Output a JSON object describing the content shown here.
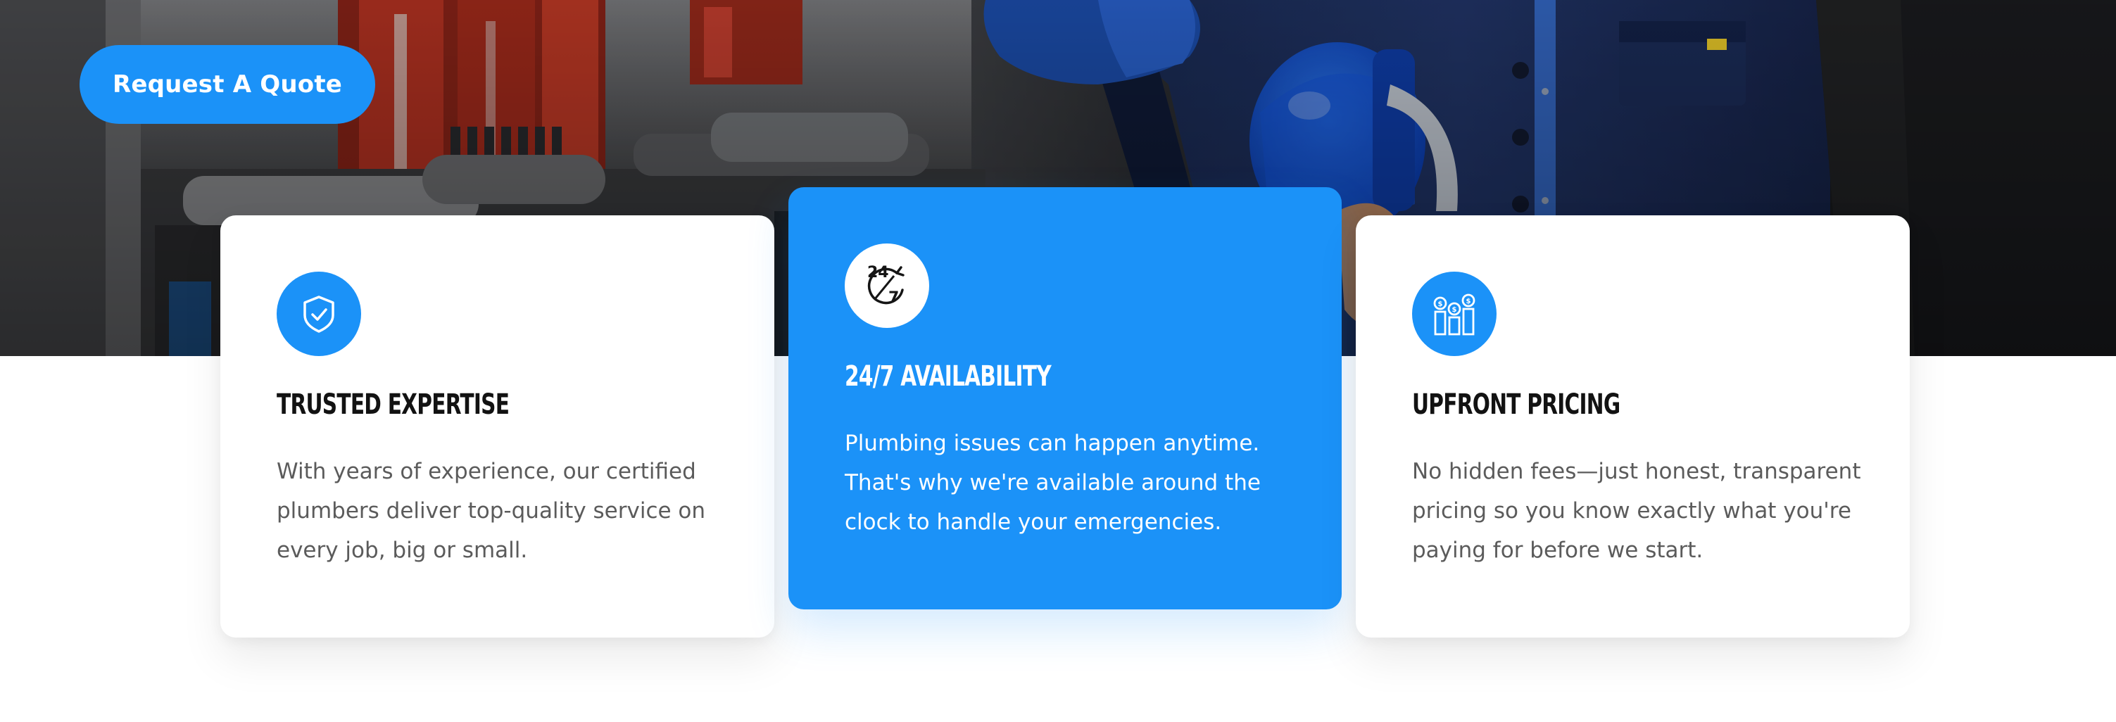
{
  "hero": {
    "cta_label": "Request A Quote"
  },
  "features": [
    {
      "icon": "shield-check-icon",
      "title": "Trusted Expertise",
      "text": "With years of experience, our certified plumbers deliver top-quality service on every job, big or small."
    },
    {
      "icon": "clock-24-7-icon",
      "title": "24/7 Availability",
      "text": "Plumbing issues can happen anytime. That's why we're available around the clock to handle your emergencies."
    },
    {
      "icon": "pricing-coins-icon",
      "title": "Upfront Pricing",
      "text": "No hidden fees—just honest, transparent pricing so you know exactly what you're paying for before we start."
    }
  ],
  "colors": {
    "accent": "#1b92f8",
    "heading": "#121212",
    "body_text": "#5b5b5b",
    "card_background": "#ffffff"
  }
}
